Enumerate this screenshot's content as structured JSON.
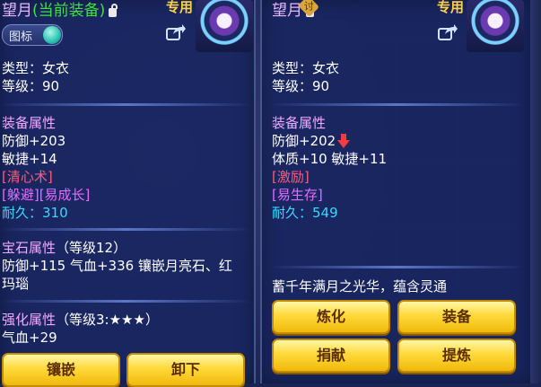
{
  "left": {
    "title_name": "望月",
    "title_tag": "(当前装备)",
    "zhuanyong": "专用",
    "icon_toggle_label": "图标",
    "type_line": "类型：女衣",
    "level_line": "等级：90",
    "attr_header": "装备属性",
    "attr_lines": [
      "防御+203",
      "敏捷+14"
    ],
    "skill_1": "[清心术]",
    "skill_2": "[躲避][易成长]",
    "durability": "耐久：310",
    "gem_header": "宝石属性",
    "gem_level": "（等级12）",
    "gem_line_1": "防御+115 气血+336 镶嵌月亮石、红",
    "gem_line_2": "玛瑙",
    "enhance_header": "强化属性",
    "enhance_level": "（等级3:★★★）",
    "enhance_line": "气血+29",
    "buttons": [
      "镶嵌",
      "卸下"
    ]
  },
  "right": {
    "title_name": "望月",
    "badge": "讨",
    "zhuanyong": "专用",
    "type_line": "类型：女衣",
    "level_line": "等级：90",
    "attr_header": "装备属性",
    "defense": "防御+202",
    "stats_line": "体质+10 敏捷+11",
    "skill_1": "[激励]",
    "skill_2": "[易生存]",
    "durability": "耐久：549",
    "description": "蓄千年满月之光华，蕴含灵通",
    "buttons": [
      "炼化",
      "装备",
      "捐献",
      "提炼"
    ]
  },
  "icons": {
    "lock": "lock-icon",
    "share": "share-icon",
    "down_arrow": "down-arrow-icon",
    "toggle_knob": "toggle-knob-icon"
  },
  "colors": {
    "button_gold": "#ffd93a",
    "header_pink": "#f3a9ff",
    "skill_red": "#ff5a7a",
    "skill_purple": "#e46cff",
    "durability_cyan": "#3ad8ff",
    "current_tag_green": "#3fe03f"
  }
}
